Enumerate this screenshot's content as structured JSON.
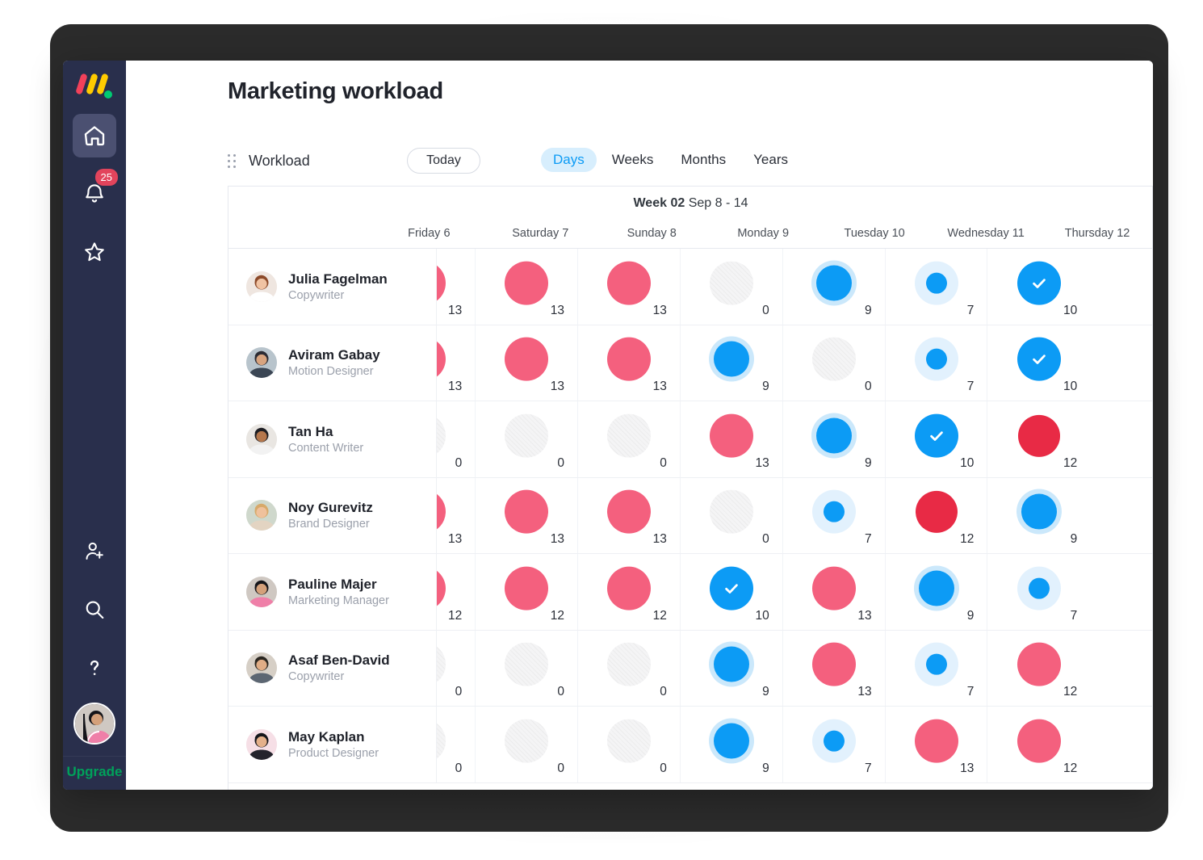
{
  "app": {
    "logo_name": "monday-logo",
    "upgrade_label": "Upgrade",
    "notification_badge": "25"
  },
  "rail": {
    "items": [
      {
        "icon": "home-icon",
        "label": "Home",
        "active": true
      },
      {
        "icon": "bell-icon",
        "label": "Notifications",
        "active": false,
        "badge": "25"
      },
      {
        "icon": "star-icon",
        "label": "Favorites",
        "active": false
      },
      {
        "icon": "add-user-icon",
        "label": "Invite members",
        "active": false
      },
      {
        "icon": "search-icon",
        "label": "Search",
        "active": false
      },
      {
        "icon": "question-mark-icon",
        "label": "Help",
        "active": false
      }
    ],
    "avatar": "user-avatar"
  },
  "header": {
    "title": "Marketing workload"
  },
  "toolbar": {
    "drag_handle_icon": "drag-dots-icon",
    "view_name": "Workload",
    "today_label": "Today",
    "range_tabs": [
      {
        "label": "Days",
        "active": true
      },
      {
        "label": "Weeks",
        "active": false
      },
      {
        "label": "Months",
        "active": false
      },
      {
        "label": "Years",
        "active": false
      }
    ]
  },
  "timeline": {
    "week_bold": "Week 02",
    "week_range": "Sep 8 - 14",
    "columns": [
      "Friday 6",
      "Saturday 7",
      "Sunday 8",
      "Monday 9",
      "Tuesday 10",
      "Wednesday 11",
      "Thursday 12"
    ],
    "rows": [
      {
        "name": "Julia Fagelman",
        "role": "Copywriter",
        "avatar_hair": "#8c4a2a",
        "avatar_skin": "#f0c3a3",
        "avatar_bg": "#efe6e0",
        "avatar_shirt": "#ffffff",
        "cells": [
          {
            "value": "13",
            "style": "pink"
          },
          {
            "value": "13",
            "style": "pink"
          },
          {
            "value": "13",
            "style": "pink"
          },
          {
            "value": "0",
            "style": "empty"
          },
          {
            "value": "9",
            "style": "blue-ring"
          },
          {
            "value": "7",
            "style": "blue-small"
          },
          {
            "value": "10",
            "style": "blue-check"
          }
        ]
      },
      {
        "name": "Aviram Gabay",
        "role": "Motion Designer",
        "avatar_hair": "#2b2b33",
        "avatar_skin": "#d8a47f",
        "avatar_bg": "#b8c4cc",
        "avatar_shirt": "#3b4654",
        "cells": [
          {
            "value": "13",
            "style": "pink"
          },
          {
            "value": "13",
            "style": "pink"
          },
          {
            "value": "13",
            "style": "pink"
          },
          {
            "value": "9",
            "style": "blue-ring"
          },
          {
            "value": "0",
            "style": "empty"
          },
          {
            "value": "7",
            "style": "blue-small"
          },
          {
            "value": "10",
            "style": "blue-check"
          }
        ]
      },
      {
        "name": "Tan Ha",
        "role": "Content Writer",
        "avatar_hair": "#1d1d22",
        "avatar_skin": "#b5774c",
        "avatar_bg": "#e9e6e2",
        "avatar_shirt": "#f2f2f2",
        "cells": [
          {
            "value": "0",
            "style": "empty"
          },
          {
            "value": "0",
            "style": "empty"
          },
          {
            "value": "0",
            "style": "empty"
          },
          {
            "value": "13",
            "style": "pink"
          },
          {
            "value": "9",
            "style": "blue-ring"
          },
          {
            "value": "10",
            "style": "blue-check"
          },
          {
            "value": "12",
            "style": "red"
          }
        ]
      },
      {
        "name": "Noy Gurevitz",
        "role": "Brand Designer",
        "avatar_hair": "#d7a96a",
        "avatar_skin": "#efc19c",
        "avatar_bg": "#cfd8cc",
        "avatar_shirt": "#e3d4c2",
        "cells": [
          {
            "value": "13",
            "style": "pink"
          },
          {
            "value": "13",
            "style": "pink"
          },
          {
            "value": "13",
            "style": "pink"
          },
          {
            "value": "0",
            "style": "empty"
          },
          {
            "value": "7",
            "style": "blue-small"
          },
          {
            "value": "12",
            "style": "red"
          },
          {
            "value": "9",
            "style": "blue-ring"
          }
        ]
      },
      {
        "name": "Pauline Majer",
        "role": "Marketing Manager",
        "avatar_hair": "#15151a",
        "avatar_skin": "#d4a07a",
        "avatar_bg": "#cfc8c2",
        "avatar_shirt": "#ef7fa8",
        "cells": [
          {
            "value": "12",
            "style": "pink"
          },
          {
            "value": "12",
            "style": "pink"
          },
          {
            "value": "12",
            "style": "pink"
          },
          {
            "value": "10",
            "style": "blue-check"
          },
          {
            "value": "13",
            "style": "pink"
          },
          {
            "value": "9",
            "style": "blue-ring"
          },
          {
            "value": "7",
            "style": "blue-small"
          }
        ]
      },
      {
        "name": "Asaf Ben-David",
        "role": "Copywriter",
        "avatar_hair": "#2a2620",
        "avatar_skin": "#e0ad86",
        "avatar_bg": "#d6cfc6",
        "avatar_shirt": "#5c6672",
        "cells": [
          {
            "value": "0",
            "style": "empty"
          },
          {
            "value": "0",
            "style": "empty"
          },
          {
            "value": "0",
            "style": "empty"
          },
          {
            "value": "9",
            "style": "blue-ring"
          },
          {
            "value": "13",
            "style": "pink"
          },
          {
            "value": "7",
            "style": "blue-small"
          },
          {
            "value": "12",
            "style": "pink"
          }
        ]
      },
      {
        "name": "May Kaplan",
        "role": "Product Designer",
        "avatar_hair": "#15151a",
        "avatar_skin": "#e4b08a",
        "avatar_bg": "#f6dfe6",
        "avatar_shirt": "#24242c",
        "cells": [
          {
            "value": "0",
            "style": "empty"
          },
          {
            "value": "0",
            "style": "empty"
          },
          {
            "value": "0",
            "style": "empty"
          },
          {
            "value": "9",
            "style": "blue-ring"
          },
          {
            "value": "7",
            "style": "blue-small"
          },
          {
            "value": "13",
            "style": "pink"
          },
          {
            "value": "12",
            "style": "pink"
          }
        ]
      }
    ]
  },
  "colors": {
    "rail_bg": "#292f4c",
    "rail_active": "#4b5071",
    "accent_blue": "#0c9bf5",
    "accent_blue_light": "#cbe8fb",
    "accent_blue_pale": "#e2f1fd",
    "accent_pink": "#f4607e",
    "accent_red": "#e82a45",
    "badge_red": "#e2445c",
    "upgrade_green": "#00a15a",
    "empty_gray": "#f4f4f5",
    "text_dark": "#20232b",
    "text_muted": "#9ba0ab"
  }
}
